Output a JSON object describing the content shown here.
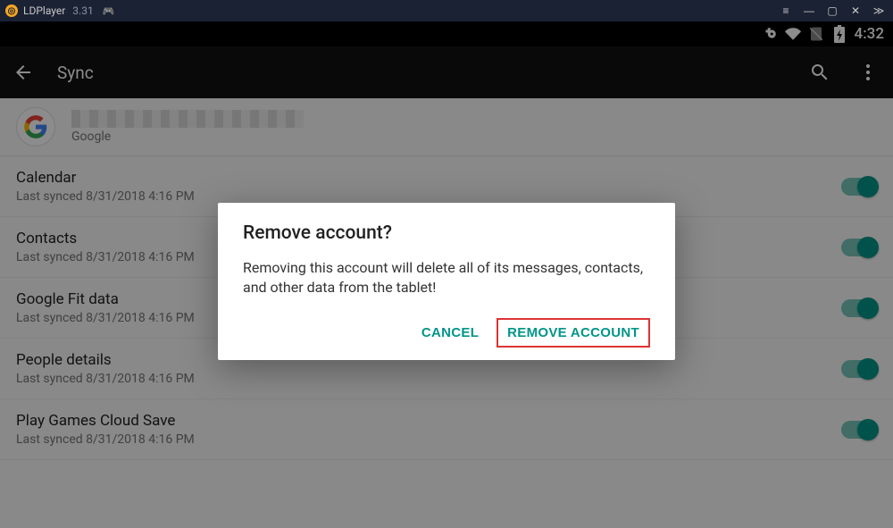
{
  "emulator": {
    "name": "LDPlayer",
    "version": "3.31"
  },
  "statusbar": {
    "clock": "4:32"
  },
  "toolbar": {
    "title": "Sync"
  },
  "account": {
    "type": "Google"
  },
  "sync_items": [
    {
      "title": "Calendar",
      "sub": "Last synced 8/31/2018 4:16 PM"
    },
    {
      "title": "Contacts",
      "sub": "Last synced 8/31/2018 4:16 PM"
    },
    {
      "title": "Google Fit data",
      "sub": "Last synced 8/31/2018 4:16 PM"
    },
    {
      "title": "People details",
      "sub": "Last synced 8/31/2018 4:16 PM"
    },
    {
      "title": "Play Games Cloud Save",
      "sub": "Last synced 8/31/2018 4:16 PM"
    }
  ],
  "dialog": {
    "title": "Remove account?",
    "body": "Removing this account will delete all of its messages, contacts, and other data from the tablet!",
    "cancel": "Cancel",
    "confirm": "Remove Account"
  }
}
